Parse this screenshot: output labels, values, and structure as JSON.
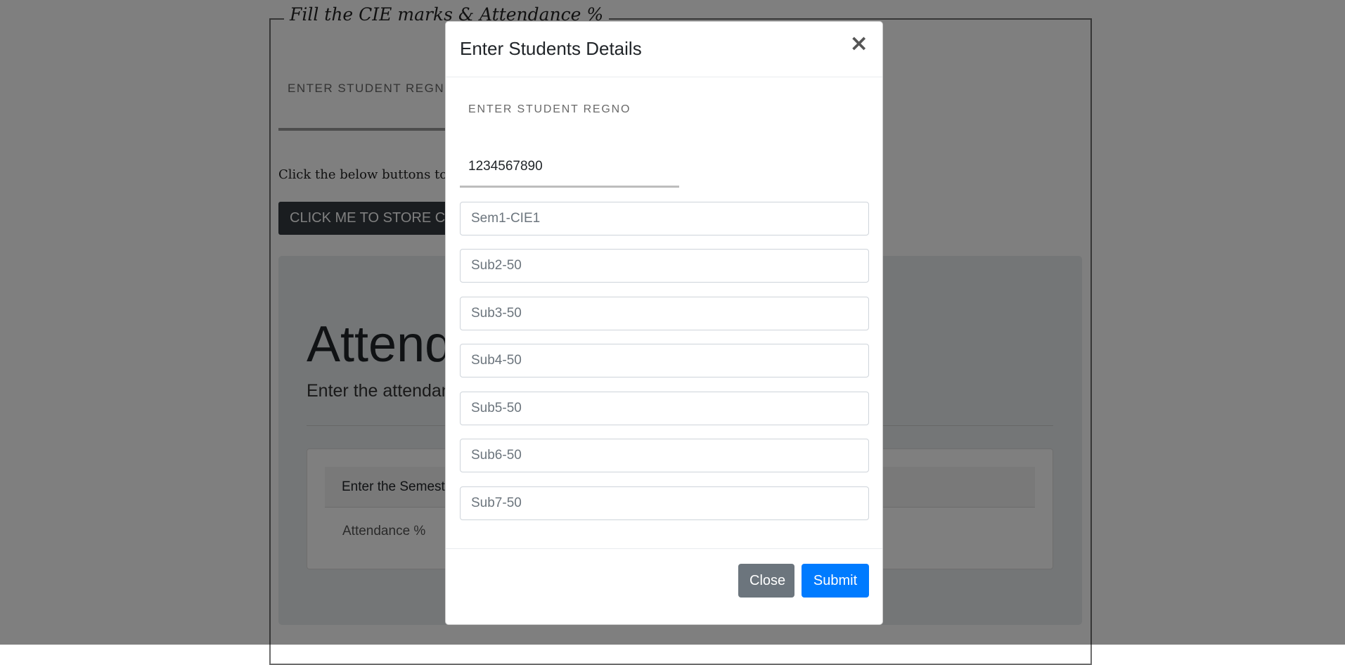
{
  "background": {
    "legend": "Fill the CIE marks & Attendance %",
    "regno_label": "ENTER STUDENT REGNO",
    "hint": "Click the below buttons to sto",
    "store_button": "CLICK ME TO STORE CIE I",
    "jumbotron_title": "Attend",
    "jumbotron_subtitle": "Enter the attendanc",
    "card_header": "Enter the Semest",
    "card_row_label": "Attendance %"
  },
  "modal": {
    "title": "Enter Students Details",
    "close_icon": "close-icon",
    "regno_label": "ENTER STUDENT REGNO",
    "regno_value": "1234567890",
    "fields": [
      {
        "placeholder": "Sem1-CIE1"
      },
      {
        "placeholder": "Sub2-50"
      },
      {
        "placeholder": "Sub3-50"
      },
      {
        "placeholder": "Sub4-50"
      },
      {
        "placeholder": "Sub5-50"
      },
      {
        "placeholder": "Sub6-50"
      },
      {
        "placeholder": "Sub7-50"
      }
    ],
    "close_button": "Close",
    "submit_button": "Submit"
  },
  "colors": {
    "primary": "#007bff",
    "secondary": "#6c757d",
    "dark": "#343a40",
    "backdrop": "rgba(0,0,0,0.5)"
  }
}
